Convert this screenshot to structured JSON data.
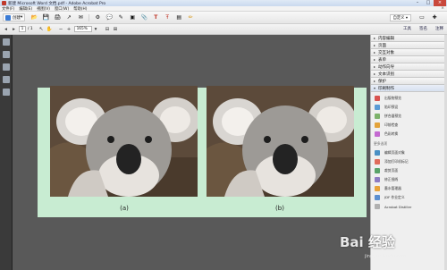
{
  "window": {
    "title": "新建 Microsoft Word 文档.pdf - Adobe Acrobat Pro",
    "min_glyph": "–",
    "max_glyph": "□",
    "close_glyph": "×"
  },
  "menubar": {
    "items": [
      "文件(F)",
      "编辑(E)",
      "视图(V)",
      "窗口(W)",
      "帮助(H)"
    ],
    "win_controls": "× "
  },
  "toolbar": {
    "create_label": "创建",
    "create_arrow": "▾",
    "customize_label": "自定义 ▾",
    "icons": [
      {
        "name": "open-icon",
        "glyph": "📂"
      },
      {
        "name": "save-icon",
        "glyph": "💾"
      },
      {
        "name": "print-icon",
        "glyph": "🖨"
      },
      {
        "name": "share-icon",
        "glyph": "↗"
      },
      {
        "name": "email-icon",
        "glyph": "✉"
      },
      {
        "name": "settings-icon",
        "glyph": "⚙"
      },
      {
        "name": "comment-icon",
        "glyph": "💬"
      },
      {
        "name": "highlight-icon",
        "glyph": "✎"
      },
      {
        "name": "stamp-icon",
        "glyph": "▣"
      },
      {
        "name": "attach-icon",
        "glyph": "📎"
      },
      {
        "name": "text-icon",
        "glyph": "T"
      },
      {
        "name": "text-edit-icon",
        "glyph": "Ŧ"
      },
      {
        "name": "note-icon",
        "glyph": "▤"
      },
      {
        "name": "pencil-icon",
        "glyph": "✏"
      }
    ],
    "right_icons": [
      {
        "name": "fit-page-icon",
        "glyph": "▭"
      },
      {
        "name": "pin-icon",
        "glyph": "✚"
      }
    ]
  },
  "navbar": {
    "prev_glyph": "◂",
    "next_glyph": "▸",
    "page_current": "1",
    "page_total": "/ 1",
    "select_glyph": "↖",
    "hand_glyph": "✋",
    "zoom_out_glyph": "−",
    "zoom_in_glyph": "+",
    "zoom_value": "165%",
    "zoom_arrow": "▾",
    "fit_glyph": "⊟",
    "fit2_glyph": "⊞",
    "tabs": [
      "工具",
      "签名",
      "注释"
    ]
  },
  "panel": {
    "sections": [
      {
        "label": "内容编辑",
        "open": false
      },
      {
        "label": "页面",
        "open": false
      },
      {
        "label": "交互对象",
        "open": false
      },
      {
        "label": "表单",
        "open": false
      },
      {
        "label": "动作向导",
        "open": false
      },
      {
        "label": "文本识别",
        "open": false
      },
      {
        "label": "保护",
        "open": false
      },
      {
        "label": "印刷制作",
        "open": true
      }
    ],
    "items_top": [
      "出版物预览",
      "陷印预设",
      "拼合器预览",
      "印前检查",
      "色彩转换"
    ],
    "more_heading": "更多选项",
    "items_more": [
      "编辑页面对象",
      "添加打印机标记",
      "裁剪页面",
      "修正细线",
      "墨水管理器",
      "JDF 作业定义",
      "Acrobat Distiller"
    ],
    "item_colors": [
      "#d9534f",
      "#5b9bd5",
      "#7db26b",
      "#e3a33b",
      "#c46ad1",
      "#4a90c4",
      "#e06b5b",
      "#5aa36a",
      "#8e7cc3",
      "#e8a33a",
      "#5b8fcf",
      "#b0b0b0"
    ]
  },
  "document": {
    "caption_a": "(a)",
    "caption_b": "(b)"
  },
  "watermark": {
    "text": "Bai 经验",
    "sub": "jingyan.baidu.com"
  }
}
